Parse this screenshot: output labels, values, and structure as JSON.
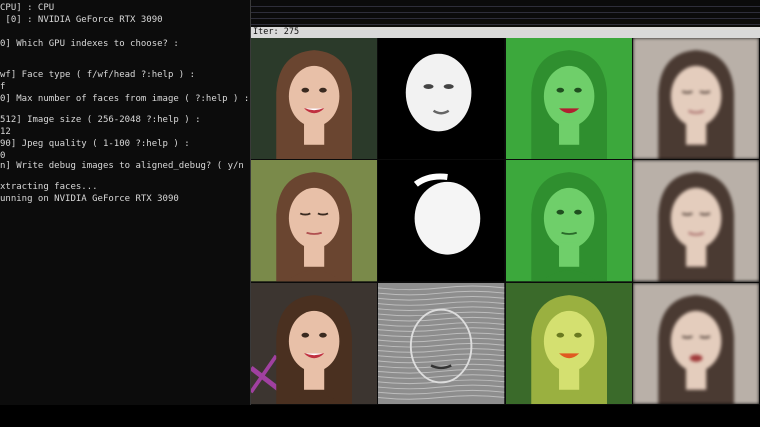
{
  "console": {
    "lines": [
      "CPU] : CPU",
      " [0] : NVIDIA GeForce RTX 3090",
      "",
      "0] Which GPU indexes to choose? :",
      "",
      "",
      "wf] Face type ( f/wf/head ?:help ) :",
      "f",
      "0] Max number of faces from image ( ?:help ) :",
      "",
      "512] Image size ( 256-2048 ?:help ) :",
      "12",
      "90] Jpeg quality ( 1-100 ?:help ) :",
      "0",
      "n] Write debug images to aligned_debug? ( y/n ) :",
      "",
      "xtracting faces...",
      "unning on NVIDIA GeForce RTX 3090"
    ]
  },
  "preview": {
    "iter_label": "Iter: 275"
  },
  "colors": {
    "terminal_bg": "#0c0c0c",
    "terminal_text": "#d8d8d8",
    "iter_bar": "#d9d9d9",
    "mask_green": "#3cb83c"
  },
  "grid": {
    "rows": [
      {
        "cells": [
          {
            "kind": "photo",
            "name": "source-face-smiling"
          },
          {
            "kind": "mask",
            "name": "mask-face-frontal"
          },
          {
            "kind": "green",
            "name": "green-overlay-smiling"
          },
          {
            "kind": "blurry",
            "name": "predicted-face-1"
          }
        ]
      },
      {
        "cells": [
          {
            "kind": "photo",
            "name": "source-face-eyes-down"
          },
          {
            "kind": "mask",
            "name": "mask-face-tilted"
          },
          {
            "kind": "green",
            "name": "green-overlay-eyes-down"
          },
          {
            "kind": "blurry",
            "name": "predicted-face-2"
          }
        ]
      },
      {
        "cells": [
          {
            "kind": "photo",
            "name": "source-face-smiling-2"
          },
          {
            "kind": "noise",
            "name": "noisy-mask"
          },
          {
            "kind": "yellow",
            "name": "yellow-overlay-face"
          },
          {
            "kind": "blurry",
            "name": "predicted-face-3"
          }
        ]
      }
    ]
  }
}
